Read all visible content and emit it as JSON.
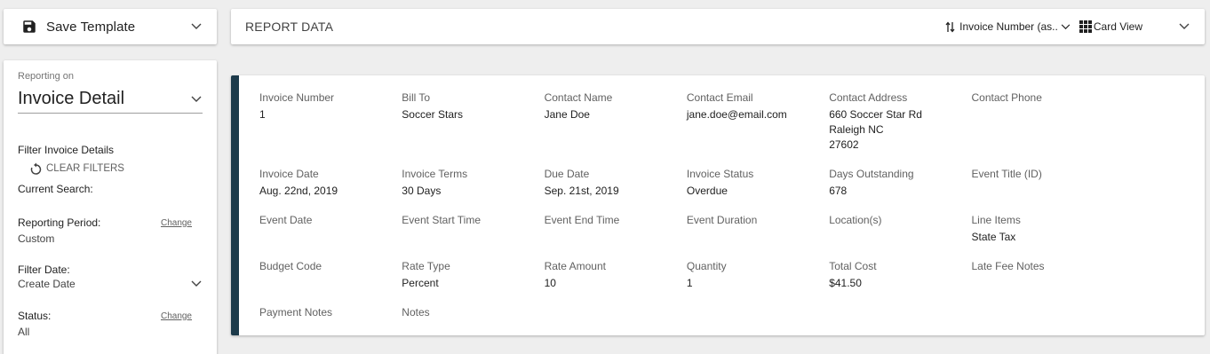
{
  "save_template": {
    "label": "Save Template"
  },
  "header": {
    "title": "REPORT DATA",
    "sort_label": "Invoice Number (as..",
    "view_label": "Card View"
  },
  "sidebar": {
    "reporting_on_label": "Reporting on",
    "report_type": "Invoice Detail",
    "filter_heading": "Filter Invoice Details",
    "clear_filters": "CLEAR FILTERS",
    "current_search": "Current Search:",
    "reporting_period": {
      "label": "Reporting Period:",
      "change": "Change",
      "value": "Custom"
    },
    "filter_date": {
      "label": "Filter Date:",
      "value": "Create Date"
    },
    "status": {
      "label": "Status:",
      "change": "Change",
      "value": "All"
    }
  },
  "detail": {
    "fields": [
      {
        "label": "Invoice Number",
        "value": "1"
      },
      {
        "label": "Bill To",
        "value": "Soccer Stars"
      },
      {
        "label": "Contact Name",
        "value": "Jane Doe"
      },
      {
        "label": "Contact Email",
        "value": "jane.doe@email.com"
      },
      {
        "label": "Contact Address",
        "value": "660 Soccer Star Rd\nRaleigh NC\n27602"
      },
      {
        "label": "Contact Phone",
        "value": ""
      },
      {
        "label": "Invoice Date",
        "value": "Aug. 22nd, 2019"
      },
      {
        "label": "Invoice Terms",
        "value": "30 Days"
      },
      {
        "label": "Due Date",
        "value": "Sep. 21st, 2019"
      },
      {
        "label": "Invoice Status",
        "value": "Overdue"
      },
      {
        "label": "Days Outstanding",
        "value": "678"
      },
      {
        "label": "Event Title (ID)",
        "value": ""
      },
      {
        "label": "Event Date",
        "value": ""
      },
      {
        "label": "Event Start Time",
        "value": ""
      },
      {
        "label": "Event End Time",
        "value": ""
      },
      {
        "label": "Event Duration",
        "value": ""
      },
      {
        "label": "Location(s)",
        "value": ""
      },
      {
        "label": "Line Items",
        "value": "State Tax"
      },
      {
        "label": "Budget Code",
        "value": ""
      },
      {
        "label": "Rate Type",
        "value": "Percent"
      },
      {
        "label": "Rate Amount",
        "value": "10"
      },
      {
        "label": "Quantity",
        "value": "1"
      },
      {
        "label": "Total Cost",
        "value": "$41.50"
      },
      {
        "label": "Late Fee Notes",
        "value": ""
      },
      {
        "label": "Payment Notes",
        "value": ""
      },
      {
        "label": "Notes",
        "value": ""
      }
    ]
  },
  "icons": {
    "save": "save-icon",
    "chevron": "chevron-down-icon",
    "sort": "sort-icon",
    "grid": "grid-view-icon",
    "undo": "undo-icon"
  },
  "colors": {
    "accent_bar": "#1c3a4a",
    "background": "#eeeeee"
  }
}
